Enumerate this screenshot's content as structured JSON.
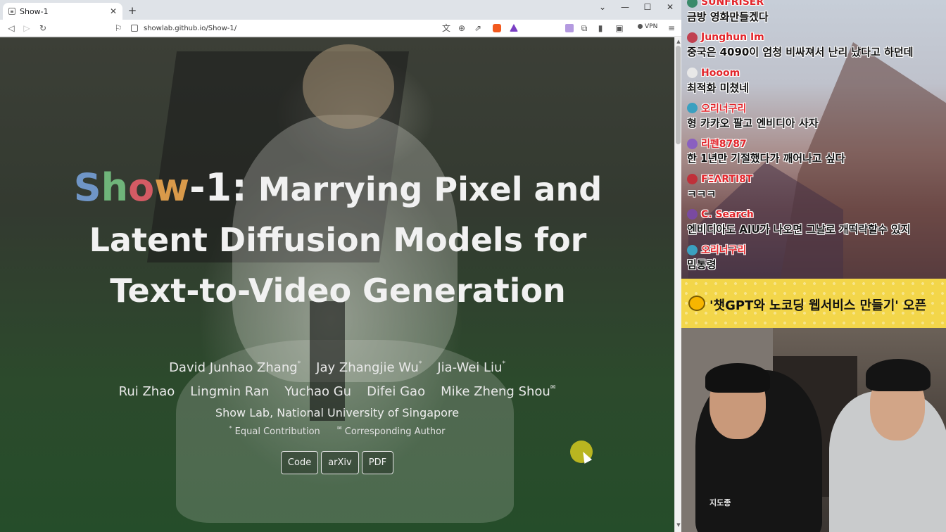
{
  "browser": {
    "tab_title": "Show-1",
    "new_tab": "+",
    "url": "showlab.github.io/Show-1/",
    "vpn_label": "VPN",
    "window_controls": [
      "chevron-down-icon",
      "minimize-icon",
      "maximize-icon",
      "close-icon"
    ]
  },
  "page": {
    "brand_letters": [
      {
        "char": "S",
        "color": "#6f95c6"
      },
      {
        "char": "h",
        "color": "#6fb57a"
      },
      {
        "char": "o",
        "color": "#d45b64"
      },
      {
        "char": "w",
        "color": "#d99a4a"
      },
      {
        "char": "-1:",
        "color": "#f1f1f1"
      }
    ],
    "title_rest": " Marrying Pixel and Latent Diffusion Models for Text-to-Video Generation",
    "authors_row1": [
      {
        "name": "David Junhao Zhang",
        "mark": "*"
      },
      {
        "name": "Jay Zhangjie Wu",
        "mark": "*"
      },
      {
        "name": "Jia-Wei Liu",
        "mark": "*"
      }
    ],
    "authors_row2": [
      {
        "name": "Rui Zhao",
        "mark": ""
      },
      {
        "name": "Lingmin Ran",
        "mark": ""
      },
      {
        "name": "Yuchao Gu",
        "mark": ""
      },
      {
        "name": "Difei Gao",
        "mark": ""
      },
      {
        "name": "Mike Zheng Shou",
        "mark": "✉"
      }
    ],
    "affiliation": "Show Lab, National University of Singapore",
    "note_equal": "Equal Contribution",
    "note_equal_mark": "*",
    "note_corr": "Corresponding Author",
    "note_corr_mark": "✉",
    "buttons": [
      "Code",
      "arXiv",
      "PDF"
    ]
  },
  "chat": {
    "messages": [
      {
        "user": "SUNFRISER",
        "text": "금방 영화만들겠다",
        "avatar_color": "#3a8a6a"
      },
      {
        "user": "Junghun Im",
        "text": "중국은 4090이 엄청 비싸져서 난리 났다고 하던데",
        "avatar_color": "#c04050"
      },
      {
        "user": "Hooom",
        "text": "최적화 미쳤네",
        "avatar_color": "#e8e8e8"
      },
      {
        "user": "오리너구리",
        "text": "형 카카오 팔고 엔비디아 사자",
        "avatar_color": "#3aa0c0"
      },
      {
        "user": "리펜8787",
        "text": "한 1년만 기절했다가 깨어나고 싶다",
        "avatar_color": "#8a60c0"
      },
      {
        "user": "FΞΛRTI8T",
        "text": "ㅋㅋㅋ",
        "avatar_color": "#c0303a"
      },
      {
        "user": "C. Search",
        "text": "엔비디아도 AIU가 나오면 그날로 개떡락할수 있지",
        "avatar_color": "#7a4aa0"
      },
      {
        "user": "오리너구리",
        "text": "밈통령",
        "avatar_color": "#3aa0c0"
      }
    ]
  },
  "banner": {
    "text": "'챗GPT와 노코딩 웹서비스 만들기' 오픈"
  },
  "cam": {
    "shirt_text": "지도종"
  }
}
